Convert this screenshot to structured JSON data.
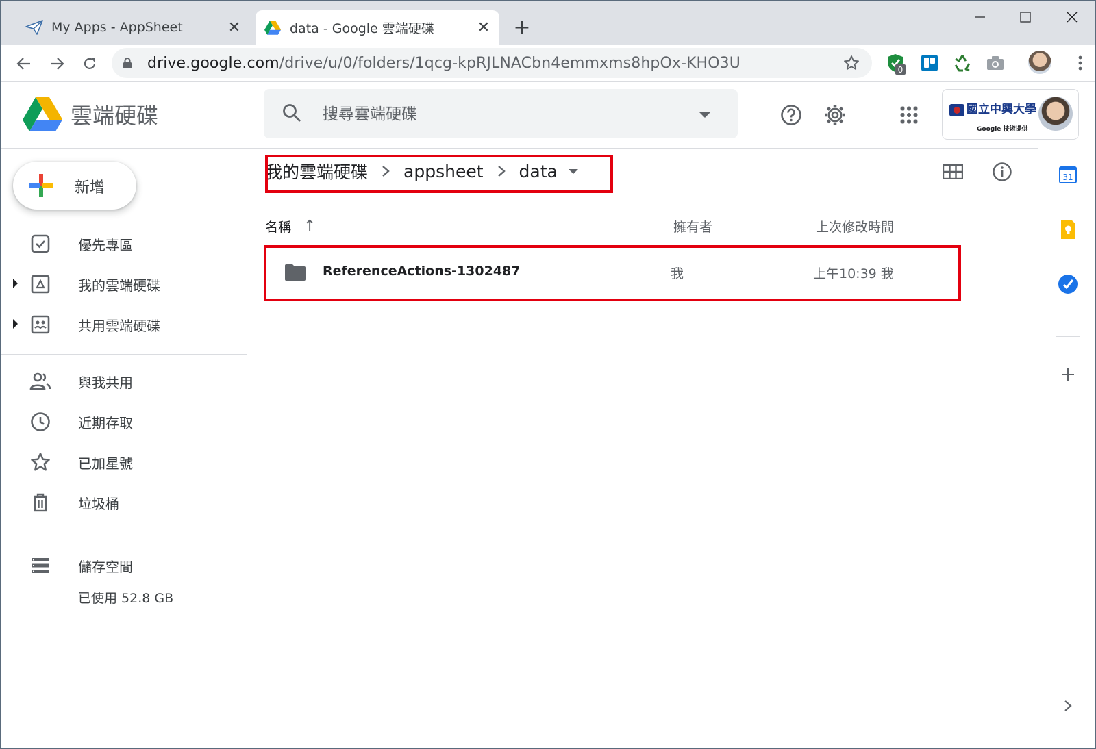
{
  "browser": {
    "tabs": [
      {
        "title": "My Apps - AppSheet",
        "icon": "appsheet-paper-plane-icon"
      },
      {
        "title": "data - Google 雲端硬碟",
        "icon": "google-drive-icon"
      }
    ],
    "url_host": "drive.google.com",
    "url_path": "/drive/u/0/folders/1qcg-kpRJLNACbn4emmxms8hpOx-KHO3U",
    "extension_badge": "0"
  },
  "drive": {
    "product_title": "雲端硬碟",
    "search_placeholder": "搜尋雲端硬碟",
    "account_school_name": "國立中興大學",
    "account_sub": "Google 技術提供",
    "new_button": "新增",
    "nav": [
      {
        "label": "優先專區",
        "icon": "priority-check-icon"
      },
      {
        "label": "我的雲端硬碟",
        "icon": "my-drive-icon"
      },
      {
        "label": "共用雲端硬碟",
        "icon": "shared-drives-icon"
      },
      {
        "label": "與我共用",
        "icon": "shared-with-me-icon"
      },
      {
        "label": "近期存取",
        "icon": "clock-icon"
      },
      {
        "label": "已加星號",
        "icon": "star-icon"
      },
      {
        "label": "垃圾桶",
        "icon": "trash-icon"
      },
      {
        "label": "儲存空間",
        "icon": "storage-icon"
      }
    ],
    "storage_used": "已使用 52.8 GB",
    "breadcrumb": [
      "我的雲端硬碟",
      "appsheet",
      "data"
    ],
    "columns": {
      "name": "名稱",
      "owner": "擁有者",
      "modified": "上次修改時間"
    },
    "files": [
      {
        "name": "ReferenceActions-1302487",
        "owner": "我",
        "modified": "上午10:39 我",
        "type": "folder"
      }
    ],
    "calendar_day": "31"
  },
  "colors": {
    "highlight_box": "#e3000f",
    "drive_blue": "#4285f4",
    "drive_green": "#0f9d58",
    "drive_yellow": "#f4b400"
  }
}
